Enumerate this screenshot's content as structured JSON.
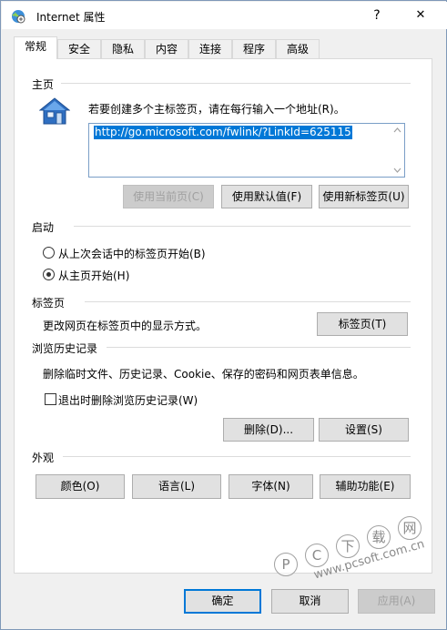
{
  "window": {
    "title": "Internet 属性",
    "help": "?",
    "close": "✕"
  },
  "tabs": [
    "常规",
    "安全",
    "隐私",
    "内容",
    "连接",
    "程序",
    "高级"
  ],
  "home": {
    "section_title": "主页",
    "instruction": "若要创建多个主标签页，请在每行输入一个地址(R)。",
    "url": "http://go.microsoft.com/fwlink/?LinkId=625115",
    "btn_current": "使用当前页(C)",
    "btn_default": "使用默认值(F)",
    "btn_newtab": "使用新标签页(U)"
  },
  "startup": {
    "section_title": "启动",
    "option_last": "从上次会话中的标签页开始(B)",
    "option_home": "从主页开始(H)",
    "selected": "home"
  },
  "tabs_section": {
    "section_title": "标签页",
    "desc": "更改网页在标签页中的显示方式。",
    "btn": "标签页(T)"
  },
  "history": {
    "section_title": "浏览历史记录",
    "desc": "删除临时文件、历史记录、Cookie、保存的密码和网页表单信息。",
    "checkbox_label": "退出时删除浏览历史记录(W)",
    "btn_delete": "删除(D)...",
    "btn_settings": "设置(S)"
  },
  "appearance": {
    "section_title": "外观",
    "btn_colors": "颜色(O)",
    "btn_languages": "语言(L)",
    "btn_fonts": "字体(N)",
    "btn_accessibility": "辅助功能(E)"
  },
  "footer": {
    "ok": "确定",
    "cancel": "取消",
    "apply": "应用(A)"
  },
  "watermark": {
    "brand": [
      "P",
      "C",
      "下",
      "载",
      "网"
    ],
    "url": "www.pcsoft.com.cn"
  },
  "colors": {
    "accent": "#0078d7",
    "watermark": "#8a8a8a"
  }
}
